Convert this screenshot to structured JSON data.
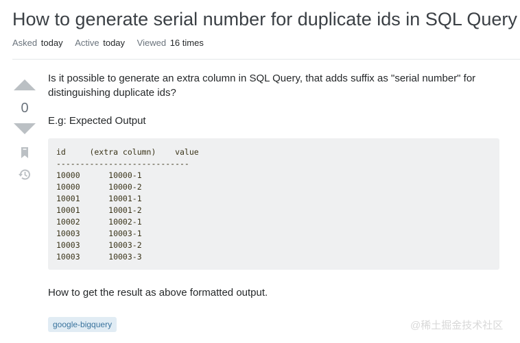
{
  "question": {
    "title": "How to generate serial number for duplicate ids in SQL Query",
    "meta": {
      "asked_label": "Asked",
      "asked_value": "today",
      "active_label": "Active",
      "active_value": "today",
      "viewed_label": "Viewed",
      "viewed_value": "16 times"
    },
    "vote_count": "0",
    "body": {
      "paragraph_1": "Is it possible to generate an extra column in SQL Query, that adds suffix as \"serial number\" for distinguishing duplicate ids?",
      "paragraph_2": "E.g: Expected Output",
      "code_block": "id     (extra column)    value\n----------------------------\n10000      10000-1\n10000      10000-2\n10001      10001-1\n10001      10001-2\n10002      10002-1\n10003      10003-1\n10003      10003-2\n10003      10003-3",
      "paragraph_3": "How to get the result as above formatted output."
    },
    "tags": [
      "google-bigquery"
    ]
  },
  "icons": {
    "upvote": "upvote-icon",
    "downvote": "downvote-icon",
    "bookmark": "bookmark-icon",
    "history": "history-icon"
  },
  "watermark": "@稀土掘金技术社区",
  "colors": {
    "vote_arrow": "#bbc0c4",
    "tag_bg": "#e1ecf4",
    "tag_text": "#39739d",
    "code_bg": "#eff0f1"
  }
}
